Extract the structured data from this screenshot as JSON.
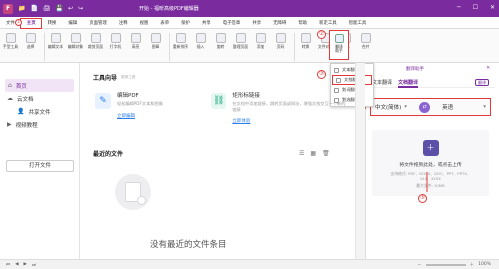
{
  "app": {
    "logo_text": "F",
    "title": "开始 - 福昕高级PDF编辑器",
    "quick_access": [
      "📁",
      "📄",
      "🖨",
      "💾",
      "↩",
      "↪"
    ]
  },
  "window_controls": {
    "minimize": "─",
    "maximize": "☐",
    "close": "✕"
  },
  "ribbon_tabs": [
    "文件",
    "主页",
    "转换",
    "编辑",
    "页面管理",
    "注释",
    "视图",
    "表单",
    "保护",
    "共享",
    "电子签章",
    "共享",
    "无障碍",
    "帮助",
    "新走工具",
    "智能工具"
  ],
  "ribbon_buttons": [
    "手型工具",
    "选择",
    "编辑文本",
    "编辑对象",
    "裁剪页面",
    "打字机",
    "高亮",
    "图章",
    "重新排序",
    "插入",
    "旋转",
    "整理页面",
    "添加",
    "页码",
    "转换",
    "文件对比",
    "OCR",
    "合并",
    "翻译",
    "文本",
    "多页面"
  ],
  "translate_button_label": "翻译\n助手",
  "annotations": {
    "step1": "①",
    "step2": "②",
    "step3": "③",
    "step4": "④",
    "step5": "⑤"
  },
  "translate_dropdown": {
    "items": [
      "文本翻译",
      "文档翻译",
      "划词翻译",
      "划选翻译"
    ]
  },
  "sidebar": {
    "items": [
      {
        "icon": "⌂",
        "label": "首页"
      },
      {
        "icon": "☁",
        "label": "云文档"
      },
      {
        "icon": "👤",
        "label": "共享文件"
      },
      {
        "icon": "▶",
        "label": "视频教程"
      }
    ],
    "open_button": "打开文件"
  },
  "main": {
    "tools_heading": "工具向导",
    "tools_badge": "更换工具",
    "tools": [
      {
        "title": "编辑PDF",
        "desc": "轻松编辑PDF文本和图像",
        "link": "立即编辑"
      },
      {
        "title": "矩形标链接",
        "desc": "在文档中添加链接，跳转页面或网址，增强文档交互一个新的链接",
        "link": "立即体验"
      }
    ],
    "recent_heading": "最近的文件",
    "empty_text": "没有最近的文件条目"
  },
  "right_panel": {
    "header": "翻译助手",
    "tabs": [
      "文本翻译",
      "文档翻译"
    ],
    "share_label": "翻译",
    "source_lang": "中文(简体)",
    "swap_icon": "⇄",
    "target_lang": "英语",
    "drop_title": "将文件拖到此处，或点击上传",
    "supported_formats": "支持格式: PDF、DOCX、DOC、PPT、PPTX、XLS、XLSX",
    "max_size": "最大文件: 10MB"
  },
  "statusbar": {
    "zoom": "100%",
    "zoom_minus": "－",
    "zoom_plus": "＋"
  },
  "colors": {
    "brand": "#7a2c9f",
    "annotation": "#e03a3a",
    "link": "#2b7de9"
  }
}
